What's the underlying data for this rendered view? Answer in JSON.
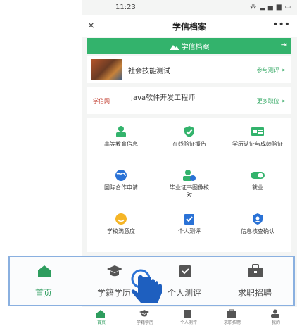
{
  "status_bar": {
    "time": "11:23",
    "icons": "⁂ ▂ ▄ ▆ ▭"
  },
  "titlebar": {
    "close": "×",
    "title": "学信档案",
    "more": "•••"
  },
  "green_bar": {
    "logo_text": "学信档案",
    "exit_icon": "⇥"
  },
  "cards": [
    {
      "title": "社会技能测试",
      "link": "参与测评 >"
    },
    {
      "brand": "学信网",
      "title": "Java软件开发工程师",
      "link": "更多职位 >"
    }
  ],
  "services": [
    {
      "label": "高等教育信息",
      "icon": "person-icon"
    },
    {
      "label": "在线验证报告",
      "icon": "shield-icon"
    },
    {
      "label": "学历认证与成绩验证",
      "icon": "id-card-icon"
    },
    {
      "label": "国际合作申请",
      "icon": "globe-icon"
    },
    {
      "label": "毕业证书图像校对",
      "icon": "user-check-icon"
    },
    {
      "label": "就业",
      "icon": "toggle-icon"
    },
    {
      "label": "学校满意度",
      "icon": "smile-icon"
    },
    {
      "label": "个人测评",
      "icon": "clipboard-icon"
    },
    {
      "label": "信息核查确认",
      "icon": "user-badge-icon"
    }
  ],
  "highlight_tabs": [
    {
      "label": "首页",
      "icon": "home-icon",
      "active": true
    },
    {
      "label": "学籍学历",
      "icon": "graduation-cap-icon",
      "active": false
    },
    {
      "label": "个人测评",
      "icon": "clipboard-check-icon",
      "active": false
    },
    {
      "label": "求职招聘",
      "icon": "briefcase-icon",
      "active": false
    }
  ],
  "bottom_nav": [
    {
      "label": "首页",
      "icon": "home-icon"
    },
    {
      "label": "学籍学历",
      "icon": "graduation-cap-icon"
    },
    {
      "label": "个人测评",
      "icon": "clipboard-check-icon"
    },
    {
      "label": "求职招聘",
      "icon": "briefcase-icon"
    },
    {
      "label": "我的",
      "icon": "user-icon"
    }
  ],
  "colors": {
    "accent": "#33b36c",
    "icon_blue": "#2a72d6",
    "highlight_border": "#8ab0e0"
  }
}
